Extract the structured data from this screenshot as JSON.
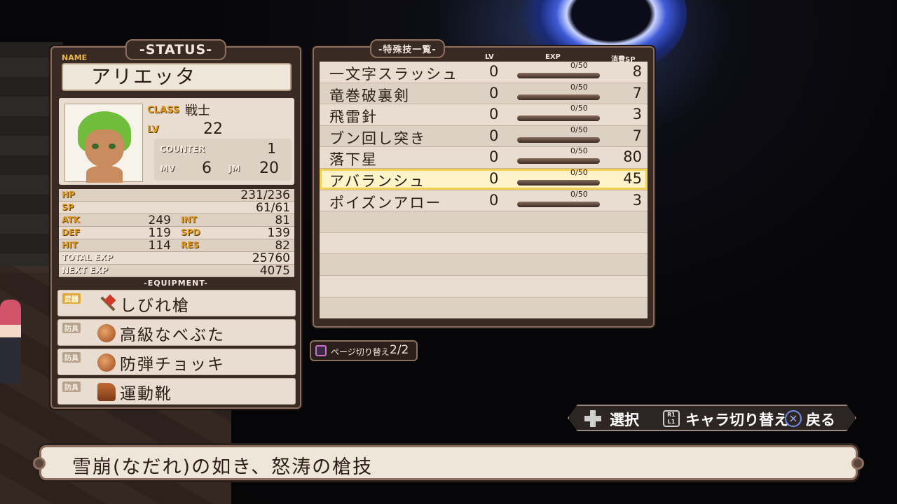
{
  "status": {
    "title": "-STATUS-",
    "name_label": "NAME",
    "name": "アリエッタ",
    "class_label": "CLASS",
    "class": "戦士",
    "lv_label": "LV",
    "lv": "22",
    "counter_label": "COUNTER",
    "counter": "1",
    "mv_label": "MV",
    "mv": "6",
    "jm_label": "JM",
    "jm": "20",
    "hp_label": "HP",
    "hp": "231/236",
    "sp_label": "SP",
    "sp": "61/61",
    "atk_label": "ATK",
    "atk": "249",
    "int_label": "INT",
    "int": "81",
    "def_label": "DEF",
    "def": "119",
    "spd_label": "SPD",
    "spd": "139",
    "hit_label": "HIT",
    "hit": "114",
    "res_label": "RES",
    "res": "82",
    "total_exp_label": "TOTAL EXP",
    "total_exp": "25760",
    "next_exp_label": "NEXT EXP",
    "next_exp": "4075",
    "equipment_label": "-EQUIPMENT-",
    "equipment": [
      {
        "type": "武器",
        "name": "しびれ槍",
        "icon": "spear-icon"
      },
      {
        "type": "防具",
        "name": "高級なべぶた",
        "icon": "pot-lid-icon"
      },
      {
        "type": "防具",
        "name": "防弾チョッキ",
        "icon": "vest-icon"
      },
      {
        "type": "防具",
        "name": "運動靴",
        "icon": "shoes-icon"
      }
    ]
  },
  "skills": {
    "title": "-特殊技一覧-",
    "col_lv": "LV",
    "col_exp": "EXP",
    "col_sp": "消費SP",
    "items": [
      {
        "name": "一文字スラッシュ",
        "lv": "0",
        "exp": "0/50",
        "exp_fill": 0,
        "sp": "8"
      },
      {
        "name": "竜巻破裏剣",
        "lv": "0",
        "exp": "0/50",
        "exp_fill": 0,
        "sp": "7"
      },
      {
        "name": "飛雷針",
        "lv": "0",
        "exp": "0/50",
        "exp_fill": 0,
        "sp": "3"
      },
      {
        "name": "ブン回し突き",
        "lv": "0",
        "exp": "0/50",
        "exp_fill": 0,
        "sp": "7"
      },
      {
        "name": "落下星",
        "lv": "0",
        "exp": "0/50",
        "exp_fill": 0,
        "sp": "80"
      },
      {
        "name": "アバランシュ",
        "lv": "0",
        "exp": "0/50",
        "exp_fill": 0,
        "sp": "45"
      },
      {
        "name": "ポイズンアロー",
        "lv": "0",
        "exp": "0/50",
        "exp_fill": 0,
        "sp": "3"
      }
    ],
    "selected_index": 5
  },
  "page_switch": {
    "label": "ページ切り替え",
    "page": "2/2"
  },
  "controls": {
    "select": "選択",
    "rl_top": "R1",
    "rl_bottom": "L1",
    "switch_char": "キャラ切り替え",
    "back": "戻る"
  },
  "description": "雪崩(なだれ)の如き、怒涛の槍技"
}
